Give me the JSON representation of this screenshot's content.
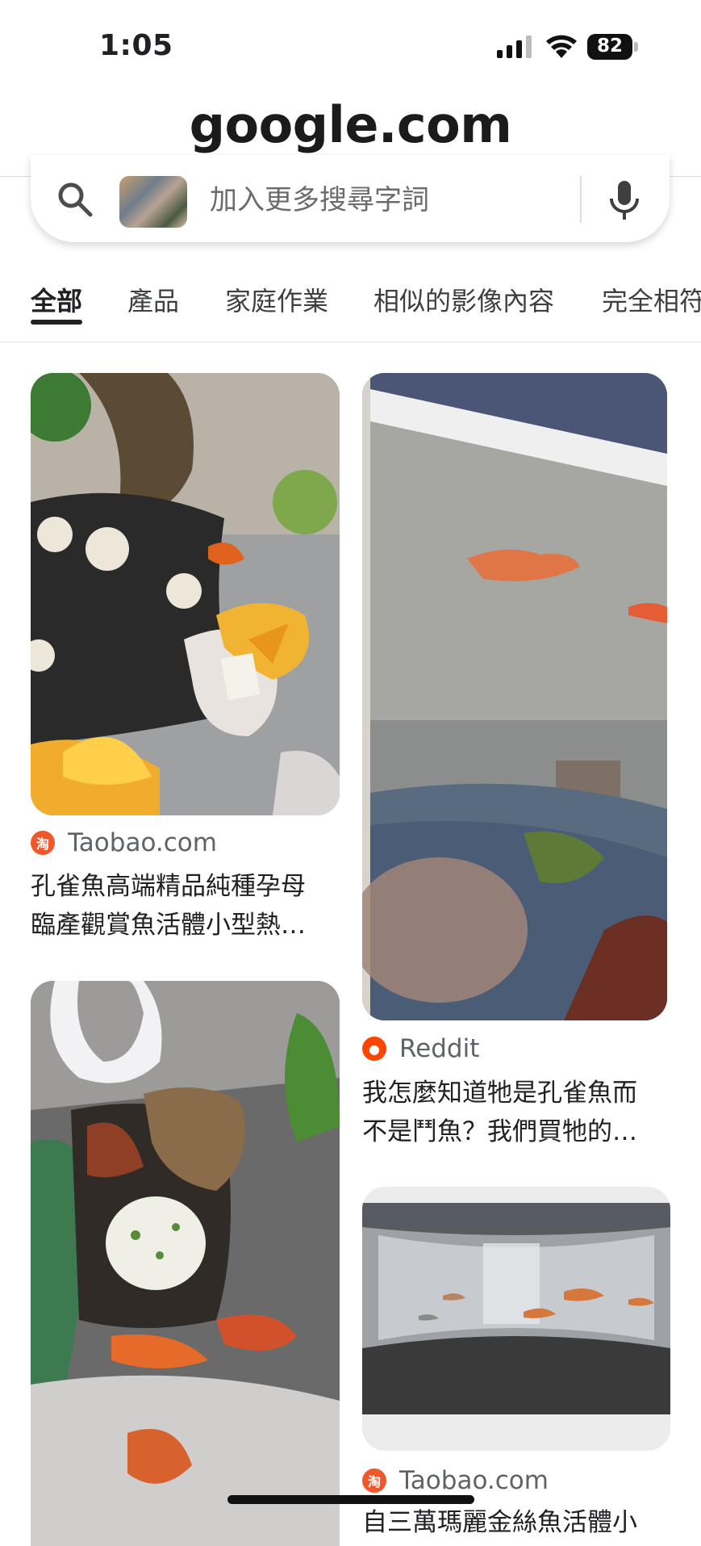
{
  "status_bar": {
    "time": "1:05",
    "battery": "82"
  },
  "browser": {
    "url": "google.com"
  },
  "search": {
    "placeholder": "加入更多搜尋字詞"
  },
  "tabs": [
    {
      "label": "全部",
      "active": true
    },
    {
      "label": "產品"
    },
    {
      "label": "家庭作業"
    },
    {
      "label": "相似的影像內容"
    },
    {
      "label": "完全相符"
    }
  ],
  "results": [
    {
      "source": "Taobao.com",
      "icon": "taobao-icon",
      "title_line1": "孔雀魚高端精品純種孕母",
      "title_line2": "臨產觀賞魚活體小型熱…"
    },
    {
      "source": "Reddit",
      "icon": "reddit-icon",
      "title_line1": "我怎麼知道牠是孔雀魚而",
      "title_line2": "不是鬥魚？我們買牠的…"
    },
    {
      "source": "Taobao.com",
      "icon": "taobao-icon",
      "title_line1": "自三萬瑪麗金絲魚活體小",
      "title_line2": ""
    }
  ],
  "colors": {
    "accent": "#202124",
    "taobao": "#f0572a",
    "reddit": "#ff4500"
  }
}
